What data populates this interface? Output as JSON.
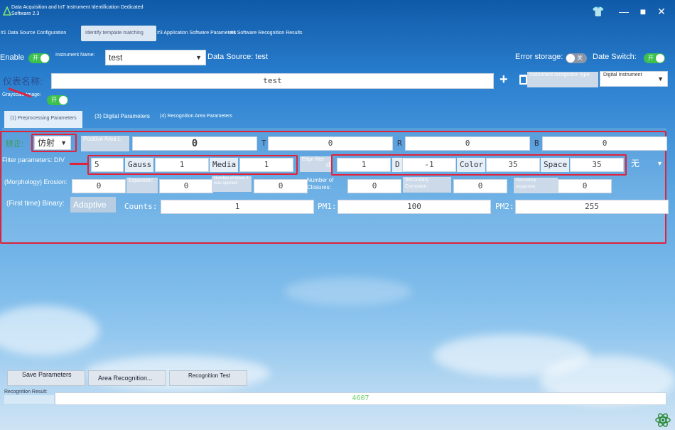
{
  "window": {
    "title": "Data Acquisition and IoT Instrument Identification Dedicated Software 2.3"
  },
  "main_tabs": [
    {
      "label": "#1 Data Source Configuration"
    },
    {
      "label": "Identify template matching"
    },
    {
      "label": "#3 Application Software Parameters"
    },
    {
      "label": "#4 Software Recognition Results"
    }
  ],
  "top_row": {
    "enable_label": "Enable",
    "enable_toggle": "开",
    "instrument_name_label": "Instrument Name:",
    "instrument_name_value": "test",
    "data_source": "Data Source: test",
    "error_storage_label": "Error storage:",
    "error_storage_toggle": "关",
    "date_switch_label": "Date Switch:",
    "date_switch_toggle": "开"
  },
  "name_row": {
    "label": "仪表名称:",
    "value": "test",
    "type_label": "Instrument recognition type:",
    "type_value": "Digital Instrument"
  },
  "grayscale": {
    "label": "Grayscale Image:",
    "toggle": "开"
  },
  "sub_tabs": [
    {
      "label": "(1) Preprocessing Parameters"
    },
    {
      "label": "(3) Digital Parameters"
    },
    {
      "label": "(4) Recognition Area Parameters"
    }
  ],
  "correction_row": {
    "label": "矫正:",
    "mode_value": "仿射",
    "positive_label": "Positive Area L",
    "positive_value": "0",
    "t_label": "T",
    "t_value": "0",
    "r_label": "R",
    "r_value": "0",
    "b_label": "B",
    "b_value": "0"
  },
  "filter_row": {
    "label": "Filter parameters: DIV",
    "div_value": "5",
    "gauss_label": "Gauss",
    "gauss_value": "1",
    "media_label": "Media",
    "media_value": "1",
    "edge_label": "Edge filter",
    "d_prefix": "d",
    "edge_value": "1",
    "d_label": "D",
    "d_value": "-1",
    "color_label": "Color",
    "color_value": "35",
    "space_label": "Space",
    "space_value": "35",
    "mode_value": "无"
  },
  "morph_row": {
    "erosion_label": "(Morphology) Erosion:",
    "erosion_value": "0",
    "expansion_label": "Expansion:",
    "expansion_value": "0",
    "opened_label": "Number of times it was opened:",
    "opened_value": "0",
    "closures_label": "Number of Closures:",
    "closures_value": "0",
    "sec_corrosion_label": "Secondary Corrosion:",
    "sec_corrosion_value": "0",
    "sec_expansion_label": "Secondary expansion:",
    "sec_expansion_value": "0"
  },
  "binary_row": {
    "label": "(First time) Binary:",
    "mode_value": "Adaptive",
    "counts_label": "Counts:",
    "counts_value": "1",
    "pm1_label": "PM1:",
    "pm1_value": "100",
    "pm2_label": "PM2:",
    "pm2_value": "255"
  },
  "buttons": {
    "save": "Save Parameters",
    "area": "Area Recognition...",
    "test": "Recognition Test"
  },
  "result": {
    "label": "Recognition Result:",
    "value": "4607"
  },
  "colors": {
    "toggle_on": "#3cc04e",
    "highlight": "#e0233a"
  }
}
